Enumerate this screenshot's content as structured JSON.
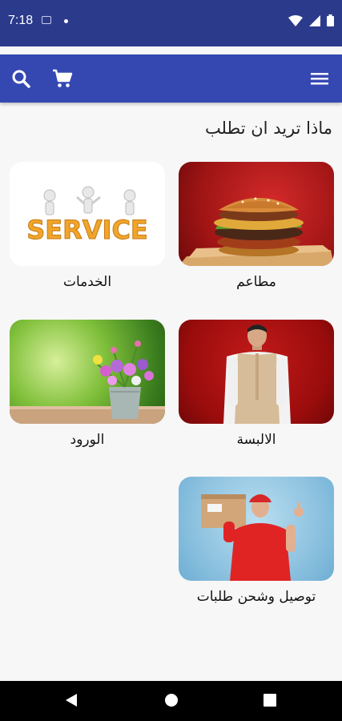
{
  "status_bar": {
    "time": "7:18"
  },
  "page": {
    "title": "ماذا تريد ان تطلب"
  },
  "categories": [
    {
      "label": "مطاعم",
      "image": "burger"
    },
    {
      "label": "الخدمات",
      "image": "service",
      "image_text": "SERVICE"
    },
    {
      "label": "الالبسة",
      "image": "clothing"
    },
    {
      "label": "الورود",
      "image": "flowers"
    },
    {
      "label": "توصيل وشحن طلبات",
      "image": "delivery"
    }
  ],
  "colors": {
    "status_bar": "#2c3a8c",
    "app_bar": "#3548b2",
    "background": "#f7f7f7",
    "nav_bar": "#000000"
  },
  "icons": [
    "search-icon",
    "cart-icon",
    "menu-icon",
    "wifi-icon",
    "signal-icon",
    "battery-icon",
    "back-icon",
    "home-icon",
    "recents-icon"
  ]
}
